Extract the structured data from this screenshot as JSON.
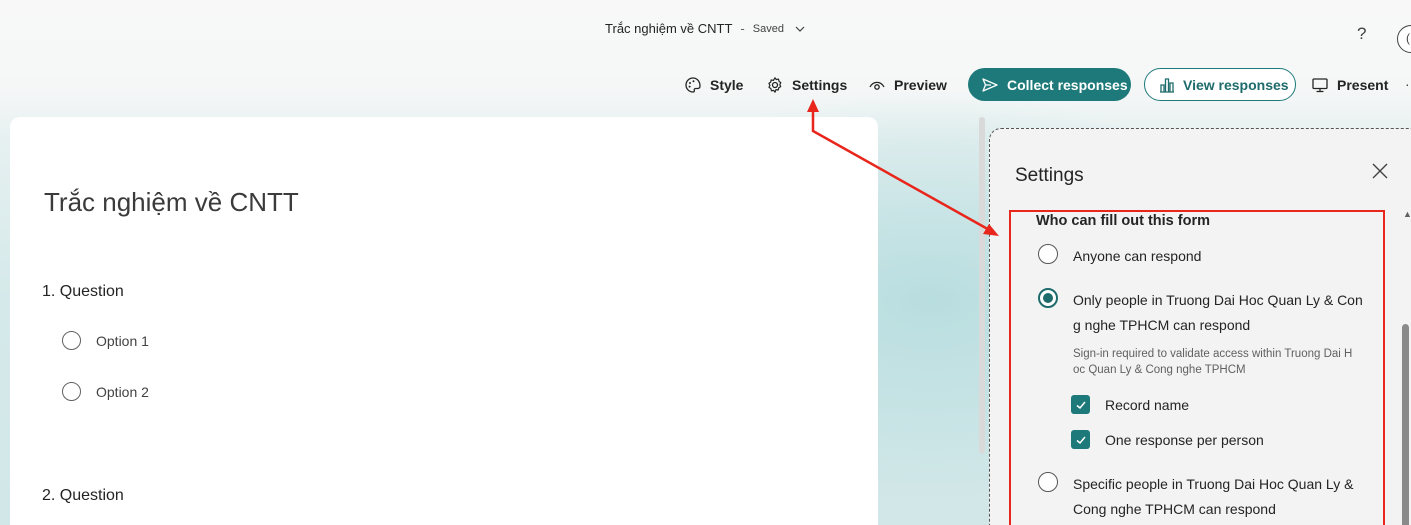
{
  "header": {
    "doc_title": "Trắc nghiệm về CNTT",
    "separator": "-",
    "saved_label": "Saved",
    "help_label": "?",
    "avatar_initial": "(",
    "more_mark": "·"
  },
  "toolbar": {
    "style_label": "Style",
    "settings_label": "Settings",
    "preview_label": "Preview",
    "collect_label": "Collect responses",
    "view_label": "View responses",
    "present_label": "Present"
  },
  "form": {
    "title": "Trắc nghiệm về CNTT",
    "questions": [
      {
        "title": "1. Question",
        "options": [
          "Option 1",
          "Option 2"
        ]
      },
      {
        "title": "2. Question"
      }
    ]
  },
  "settings": {
    "title": "Settings",
    "section_title": "Who can fill out this form",
    "options": [
      {
        "label": "Anyone can respond",
        "selected": false
      },
      {
        "label": "Only people in Truong Dai Hoc Quan Ly & Cong nghe TPHCM can respond",
        "selected": true
      },
      {
        "label": "Specific people in Truong Dai Hoc Quan Ly & Cong nghe TPHCM can respond",
        "selected": false
      }
    ],
    "hint": "Sign-in required to validate access within Truong Dai Hoc Quan Ly & Cong nghe TPHCM",
    "checkboxes": [
      {
        "label": "Record name",
        "checked": true
      },
      {
        "label": "One response per person",
        "checked": true
      }
    ]
  },
  "colors": {
    "accent": "#1e7a7a",
    "annotation": "#e8261c"
  }
}
